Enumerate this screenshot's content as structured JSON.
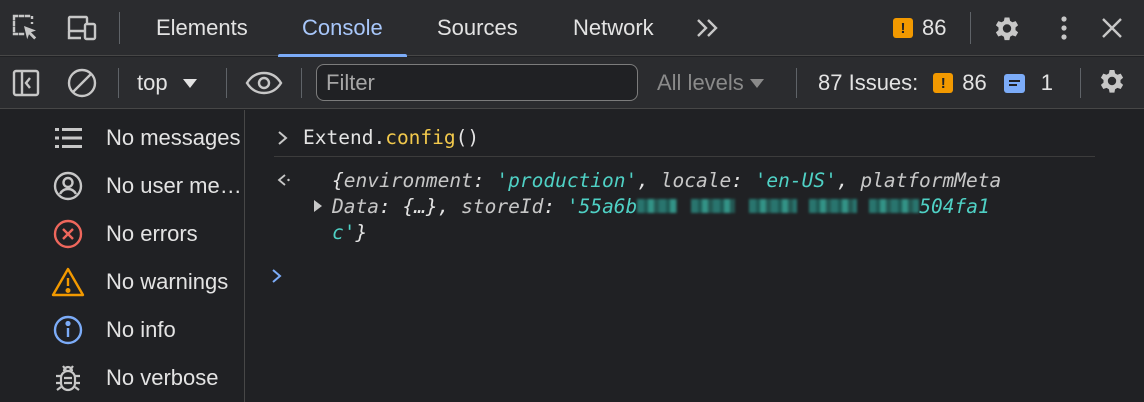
{
  "tabbar": {
    "tabs": [
      {
        "label": "Elements"
      },
      {
        "label": "Console"
      },
      {
        "label": "Sources"
      },
      {
        "label": "Network"
      }
    ],
    "more_tabs_label": ">>",
    "warning_count": "86"
  },
  "toolbar": {
    "context": "top",
    "filter_placeholder": "Filter",
    "levels_label": "All levels",
    "issues_label": "87 Issues:",
    "issues_warnings": "86",
    "issues_info": "1"
  },
  "sidebar": {
    "items": [
      {
        "label": "No messages",
        "icon": "list-icon"
      },
      {
        "label": "No user messages",
        "icon": "user-icon"
      },
      {
        "label": "No errors",
        "icon": "error-icon"
      },
      {
        "label": "No warnings",
        "icon": "warning-icon"
      },
      {
        "label": "No info",
        "icon": "info-icon"
      },
      {
        "label": "No verbose",
        "icon": "bug-icon"
      }
    ]
  },
  "console": {
    "input": {
      "object": "Extend",
      "dot": ".",
      "method": "config",
      "parens": "()"
    },
    "result": {
      "open": "{",
      "k1": "environment",
      "v1": "'production'",
      "k2": "locale",
      "v2": "'en-US'",
      "k3a": "platformMeta",
      "k3b": "Data",
      "v3": "{…}",
      "k4": "storeId",
      "v4_start": "'55a6b",
      "v4_end": "504fa1",
      "v4_wrap": "c'",
      "close": "}"
    }
  },
  "colors": {
    "accent": "#a8c7fa",
    "warning": "#f29900",
    "error": "#ee675c",
    "string": "#4fd1c5"
  }
}
